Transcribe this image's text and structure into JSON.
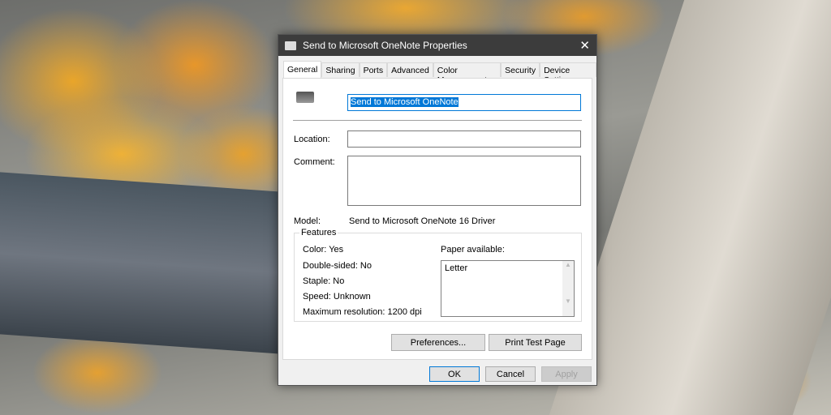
{
  "window": {
    "title": "Send to Microsoft OneNote Properties",
    "close": "✕"
  },
  "tabs": [
    "General",
    "Sharing",
    "Ports",
    "Advanced",
    "Color Management",
    "Security",
    "Device Settings"
  ],
  "general": {
    "printer_name": "Send to Microsoft OneNote",
    "location_label": "Location:",
    "location_value": "",
    "comment_label": "Comment:",
    "comment_value": "",
    "model_label": "Model:",
    "model_value": "Send to Microsoft OneNote 16 Driver",
    "features_label": "Features",
    "color": "Color: Yes",
    "double_sided": "Double-sided: No",
    "staple": "Staple: No",
    "speed": "Speed: Unknown",
    "max_res": "Maximum resolution: 1200 dpi",
    "paper_label": "Paper available:",
    "paper": [
      "Letter"
    ],
    "preferences": "Preferences...",
    "print_test": "Print Test Page"
  },
  "footer": {
    "ok": "OK",
    "cancel": "Cancel",
    "apply": "Apply"
  }
}
